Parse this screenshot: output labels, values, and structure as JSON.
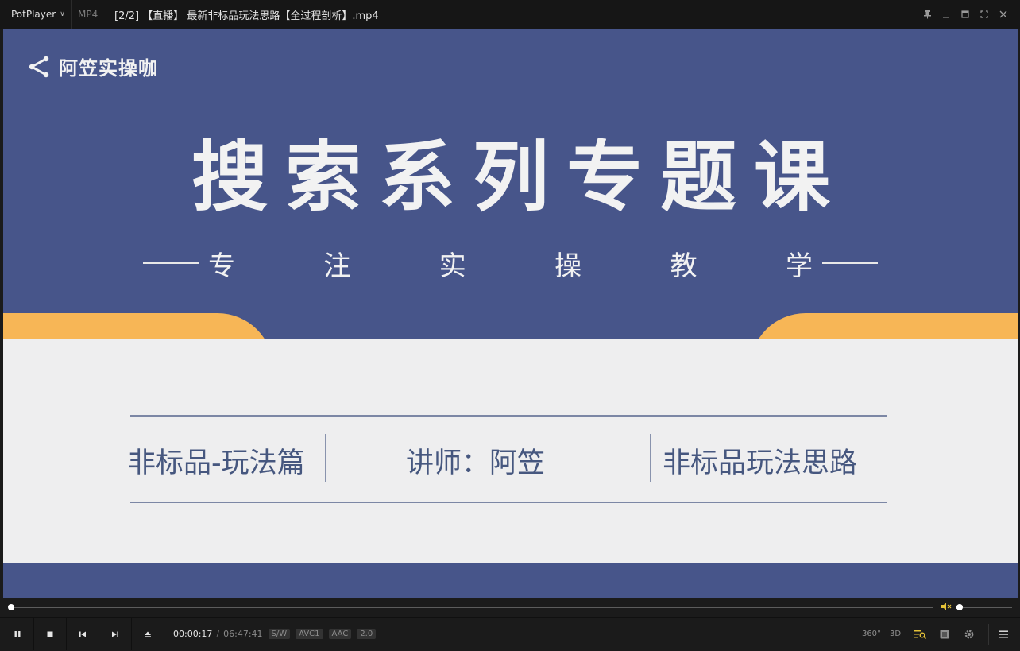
{
  "titlebar": {
    "app_name": "PotPlayer",
    "format": "MP4",
    "file_title": "[2/2] 【直播】 最新非标品玩法思路【全过程剖析】.mp4",
    "controls": [
      "pin-icon",
      "minimize-icon",
      "maximize-icon",
      "fullscreen-icon",
      "close-icon"
    ]
  },
  "video": {
    "logo_text": "阿笠实操咖",
    "headline": "搜索系列专题课",
    "subline_chars": [
      "专",
      "注",
      "实",
      "操",
      "教",
      "学"
    ],
    "info_left": "非标品-玩法篇",
    "info_center": "讲师：阿笠",
    "info_right": "非标品玩法思路",
    "colors": {
      "navy": "#47558a",
      "orange": "#f7b656",
      "panel": "#eeeeef",
      "text_dark": "#46577f"
    }
  },
  "seekbar": {
    "progress": 0.0007,
    "volume": 0.05,
    "volume_muted_icon": "mute-speaker-icon"
  },
  "controls": {
    "buttons": [
      "pause-icon",
      "stop-icon",
      "previous-icon",
      "next-icon",
      "eject-icon"
    ],
    "current_time": "00:00:17",
    "separator": "/",
    "total_time": "06:47:41",
    "tags": [
      "S/W",
      "AVC1",
      "AAC",
      "2.0"
    ],
    "right_buttons": {
      "vr": "360°",
      "three_d": "3D"
    }
  }
}
